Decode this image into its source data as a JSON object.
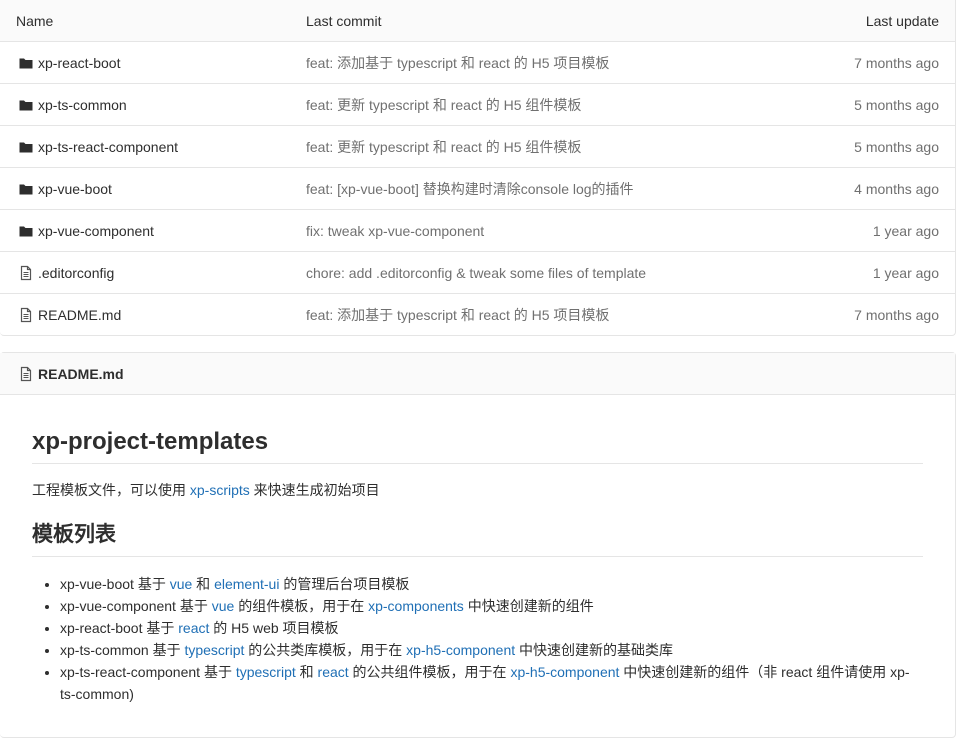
{
  "table": {
    "headers": {
      "name": "Name",
      "commit": "Last commit",
      "update": "Last update"
    },
    "rows": [
      {
        "icon": "folder-icon",
        "name": "xp-react-boot",
        "commit": "feat: 添加基于 typescript 和 react 的 H5 项目模板",
        "update": "7 months ago"
      },
      {
        "icon": "folder-icon",
        "name": "xp-ts-common",
        "commit": "feat: 更新 typescript 和 react 的 H5 组件模板",
        "update": "5 months ago"
      },
      {
        "icon": "folder-icon",
        "name": "xp-ts-react-component",
        "commit": "feat: 更新 typescript 和 react 的 H5 组件模板",
        "update": "5 months ago"
      },
      {
        "icon": "folder-icon",
        "name": "xp-vue-boot",
        "commit": "feat: [xp-vue-boot] 替换构建时清除console log的插件",
        "update": "4 months ago"
      },
      {
        "icon": "folder-icon",
        "name": "xp-vue-component",
        "commit": "fix: tweak xp-vue-component",
        "update": "1 year ago"
      },
      {
        "icon": "file-icon",
        "name": ".editorconfig",
        "commit": "chore: add .editorconfig & tweak some files of template",
        "update": "1 year ago"
      },
      {
        "icon": "file-icon",
        "name": "README.md",
        "commit": "feat: 添加基于 typescript 和 react 的 H5 项目模板",
        "update": "7 months ago"
      }
    ]
  },
  "readme": {
    "filename": "README.md",
    "title": "xp-project-templates",
    "intro": {
      "before": "工程模板文件，可以使用 ",
      "link": "xp-scripts",
      "after": " 来快速生成初始项目"
    },
    "section_title": "模板列表",
    "items": [
      {
        "t1": "xp-vue-boot 基于 ",
        "l1": "vue",
        "t2": " 和 ",
        "l2": "element-ui",
        "t3": " 的管理后台项目模板"
      },
      {
        "t1": "xp-vue-component 基于 ",
        "l1": "vue",
        "t2": " 的组件模板，用于在 ",
        "l2": "xp-components",
        "t3": " 中快速创建新的组件"
      },
      {
        "t1": "xp-react-boot 基于 ",
        "l1": "react",
        "t2": " 的 H5 web 项目模板"
      },
      {
        "t1": "xp-ts-common 基于 ",
        "l1": "typescript",
        "t2": " 的公共类库模板，用于在 ",
        "l2": "xp-h5-component",
        "t3": " 中快速创建新的基础类库"
      },
      {
        "t1": "xp-ts-react-component 基于 ",
        "l1": "typescript",
        "t2": " 和 ",
        "l2": "react",
        "t3": " 的公共组件模板，用于在 ",
        "l3": "xp-h5-component",
        "t4": " 中快速创建新的组件（非 react 组件请使用 xp-ts-common)"
      }
    ]
  },
  "colors": {
    "link": "#1f6fb5",
    "muted": "#707070",
    "border": "#e5e5e5",
    "header_bg": "#fafafa"
  }
}
